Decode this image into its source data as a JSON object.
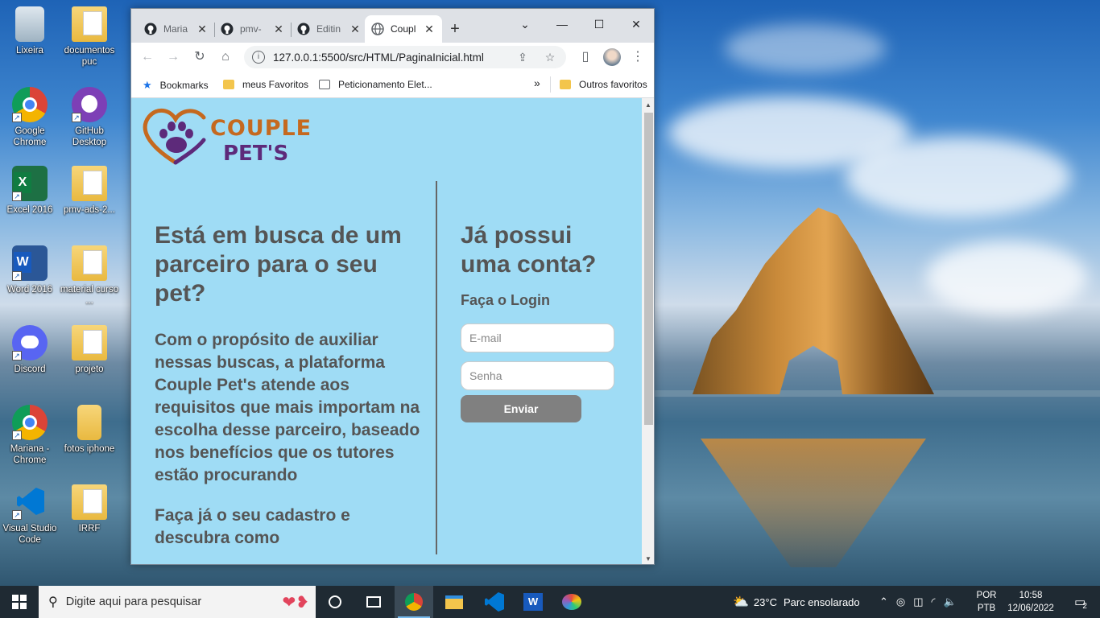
{
  "desktop": {
    "icons": [
      {
        "label": "Lixeira",
        "icon": "recycle-bin-icon"
      },
      {
        "label": "documentos puc",
        "icon": "folder-icon"
      },
      {
        "label": "Google Chrome",
        "icon": "chrome-icon"
      },
      {
        "label": "GitHub Desktop",
        "icon": "github-icon"
      },
      {
        "label": "Excel 2016",
        "icon": "excel-icon"
      },
      {
        "label": "pmv-ads-2...",
        "icon": "folder-icon"
      },
      {
        "label": "Word 2016",
        "icon": "word-icon"
      },
      {
        "label": "material curso ...",
        "icon": "folder-icon"
      },
      {
        "label": "Discord",
        "icon": "discord-icon"
      },
      {
        "label": "projeto",
        "icon": "folder-icon"
      },
      {
        "label": "Mariana - Chrome",
        "icon": "chrome-profile-icon"
      },
      {
        "label": "fotos iphone",
        "icon": "folder-icon"
      },
      {
        "label": "Visual Studio Code",
        "icon": "vscode-icon"
      },
      {
        "label": "IRRF",
        "icon": "folder-icon"
      }
    ]
  },
  "browser": {
    "tabs": [
      {
        "title": "Maria",
        "icon": "github-icon"
      },
      {
        "title": "pmv-",
        "icon": "github-icon"
      },
      {
        "title": "Editin",
        "icon": "github-icon"
      },
      {
        "title": "Coupl",
        "icon": "globe-icon",
        "active": true
      }
    ],
    "url": "127.0.0.1:5500/src/HTML/PaginaInicial.html",
    "bookmarks": {
      "items": [
        "Bookmarks",
        "meus Favoritos",
        "Peticionamento Elet..."
      ],
      "overflow": "»",
      "other": "Outros favoritos"
    }
  },
  "page": {
    "logo": {
      "line1": "COUPLE",
      "line2": "PET'S"
    },
    "headline": "Está em busca de um parceiro para o seu pet?",
    "description": "Com o propósito de auxiliar nessas buscas, a plataforma Couple Pet's atende aos requisitos que mais importam na escolha desse parceiro, baseado nos benefícios que os tutores estão procurando",
    "cta": "Faça já o seu cadastro e descubra como",
    "login": {
      "title": "Já possui uma conta?",
      "subtitle": "Faça o Login",
      "email_placeholder": "E-mail",
      "password_placeholder": "Senha",
      "submit": "Enviar"
    }
  },
  "taskbar": {
    "search_placeholder": "Digite aqui para pesquisar",
    "weather": {
      "temp": "23°C",
      "desc": "Parc ensolarado"
    },
    "lang": {
      "line1": "POR",
      "line2": "PTB"
    },
    "time": "10:58",
    "date": "12/06/2022",
    "notifications": "2"
  }
}
